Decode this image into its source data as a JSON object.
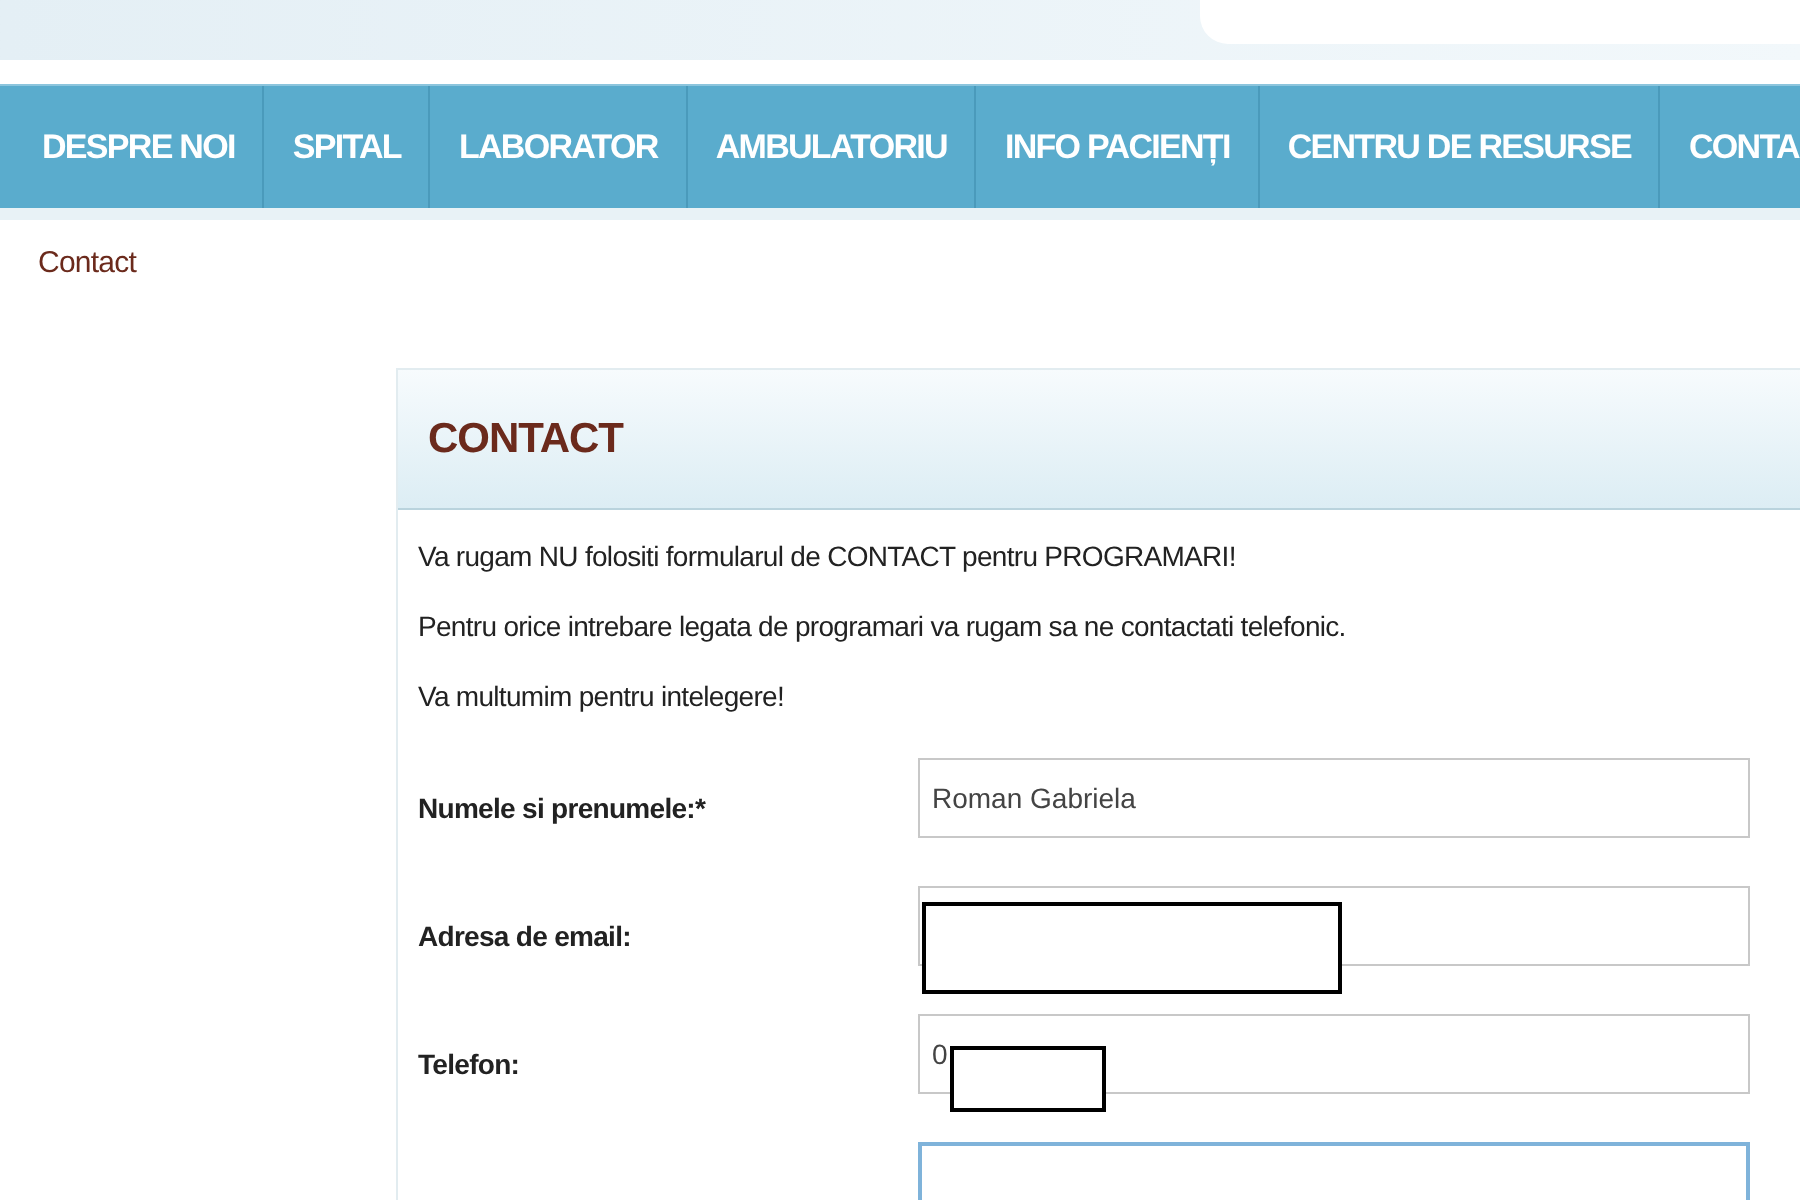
{
  "nav": [
    {
      "label": "DESPRE NOI"
    },
    {
      "label": "SPITAL"
    },
    {
      "label": "LABORATOR"
    },
    {
      "label": "AMBULATORIU"
    },
    {
      "label": "INFO PACIENȚI"
    },
    {
      "label": "CENTRU DE RESURSE"
    },
    {
      "label": "CONTA"
    }
  ],
  "breadcrumb": "Contact",
  "panel": {
    "title": "CONTACT",
    "notes": [
      "Va rugam NU folositi formularul de CONTACT pentru PROGRAMARI!",
      "Pentru orice intrebare legata de programari va rugam sa ne contactati telefonic.",
      "Va multumim pentru intelegere!"
    ],
    "fields": [
      {
        "label": "Numele si prenumele:*",
        "value": "Roman Gabriela",
        "focused": false,
        "redacted": false
      },
      {
        "label": "Adresa de email:",
        "focused": false,
        "redacted": true
      },
      {
        "label": "Telefon:",
        "value": "0",
        "focused": false,
        "redacted": true
      },
      {
        "focused": true,
        "redacted": false
      }
    ]
  }
}
